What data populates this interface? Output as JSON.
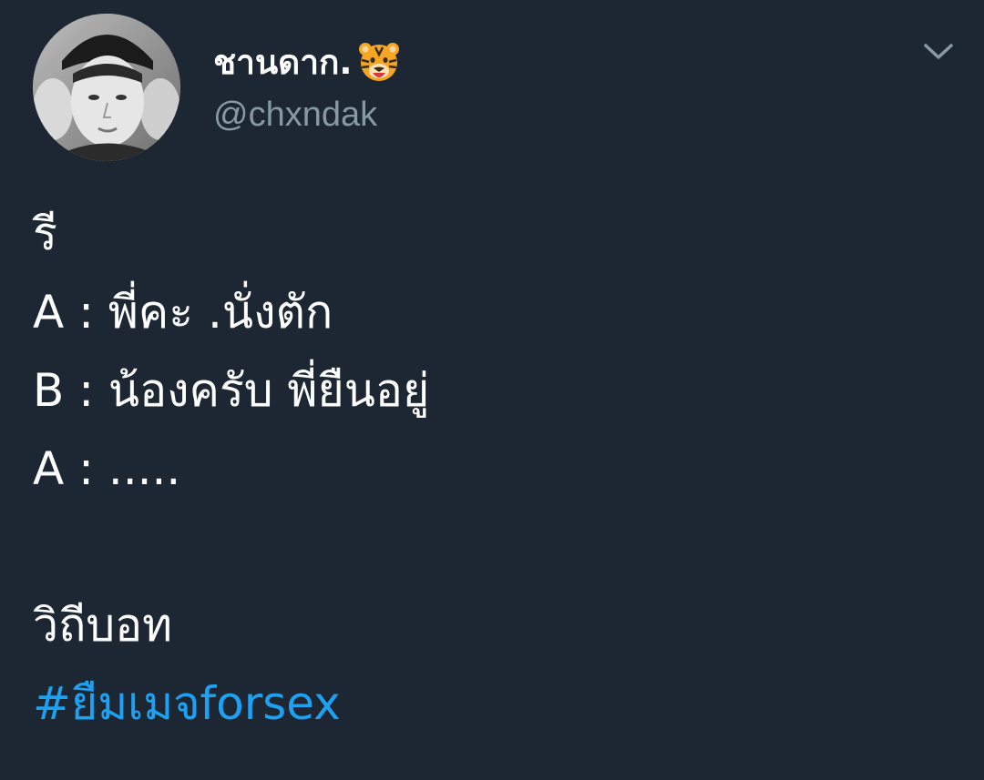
{
  "tweet": {
    "author": {
      "display_name": "ชานดาก.",
      "handle": "@chxndak",
      "name_emoji": "tiger-face-emoji"
    },
    "lines": [
      "รี",
      "A : พี่คะ .นั่งตัก",
      "B : น้องครับ พี่ยืนอยู่",
      "A : .....",
      "",
      "วิถีบอท"
    ],
    "hashtag": "#ยืมเมจforsex"
  },
  "icons": {
    "menu": "chevron-down-icon",
    "avatar": "profile-photo"
  },
  "colors": {
    "background": "#1c2733",
    "primary_text": "#ffffff",
    "secondary_text": "#8899a6",
    "link": "#1da1f2"
  }
}
